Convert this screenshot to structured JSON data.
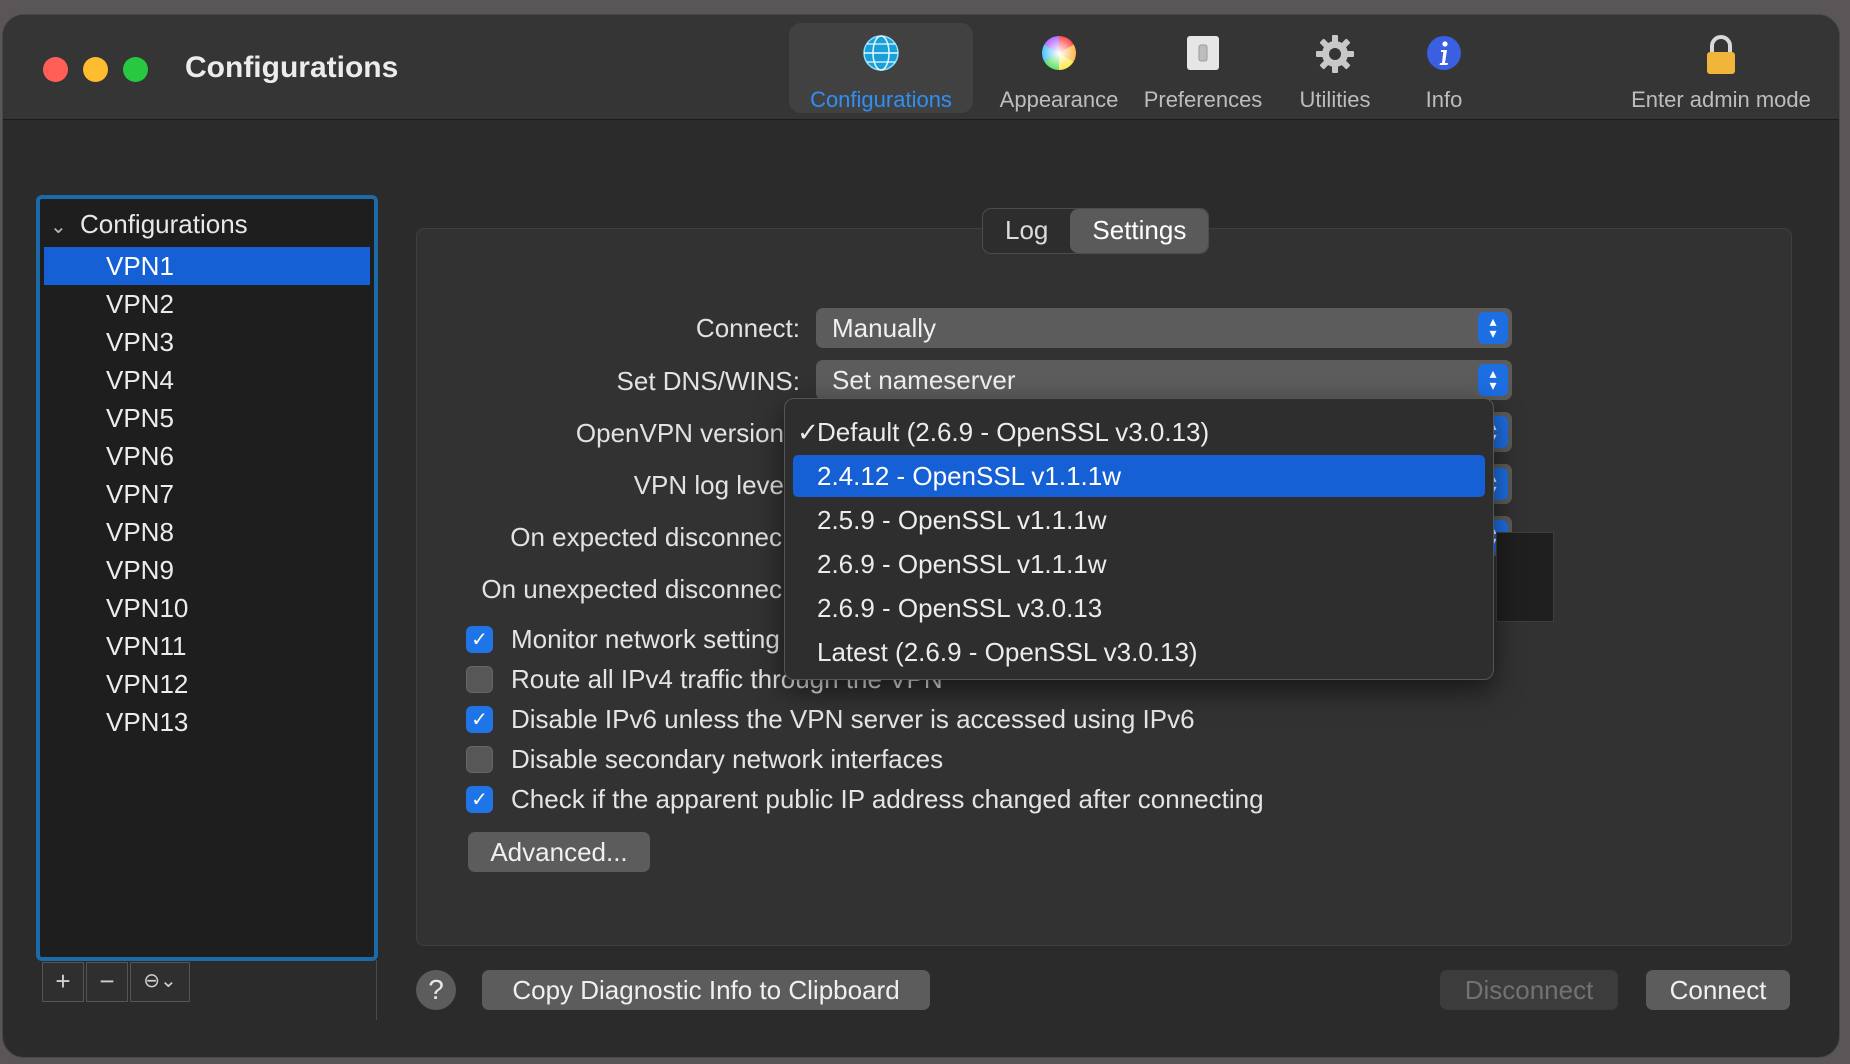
{
  "window": {
    "title": "Configurations"
  },
  "toolbar": {
    "items": [
      {
        "label": "Configurations",
        "icon": "globe-icon"
      },
      {
        "label": "Appearance",
        "icon": "color-wheel-icon"
      },
      {
        "label": "Preferences",
        "icon": "switch-icon"
      },
      {
        "label": "Utilities",
        "icon": "gear-icon"
      },
      {
        "label": "Info",
        "icon": "info-icon"
      }
    ],
    "admin": {
      "label": "Enter admin mode",
      "icon": "lock-icon"
    }
  },
  "sidebar": {
    "group_label": "Configurations",
    "items": [
      "VPN1",
      "VPN2",
      "VPN3",
      "VPN4",
      "VPN5",
      "VPN6",
      "VPN7",
      "VPN8",
      "VPN9",
      "VPN10",
      "VPN11",
      "VPN12",
      "VPN13"
    ],
    "selected": "VPN1",
    "tools": {
      "add": "+",
      "remove": "−",
      "more": "⊖⌄"
    }
  },
  "tabs": {
    "log": "Log",
    "settings": "Settings",
    "active": "Settings"
  },
  "settings": {
    "connect_label": "Connect:",
    "connect_value": "Manually",
    "dns_label": "Set DNS/WINS:",
    "dns_value": "Set nameserver",
    "openvpn_version_label": "OpenVPN version",
    "log_level_label": "VPN log leve",
    "expected_disconnect_label": "On expected disconnec",
    "unexpected_disconnect_label": "On unexpected disconnec",
    "checkboxes": [
      {
        "label": "Monitor network setting",
        "checked": true
      },
      {
        "label": "Route all IPv4 traffic through the VPN",
        "checked": false
      },
      {
        "label": "Disable IPv6 unless the VPN server is accessed using IPv6",
        "checked": true
      },
      {
        "label": "Disable secondary network interfaces",
        "checked": false
      },
      {
        "label": "Check if the apparent public IP address changed after connecting",
        "checked": true
      }
    ],
    "advanced_button": "Advanced..."
  },
  "version_menu": {
    "items": [
      "Default (2.6.9 - OpenSSL v3.0.13)",
      "2.4.12 - OpenSSL v1.1.1w",
      "2.5.9 - OpenSSL v1.1.1w",
      "2.6.9 - OpenSSL v1.1.1w",
      "2.6.9 - OpenSSL v3.0.13",
      "Latest (2.6.9 - OpenSSL v3.0.13)"
    ],
    "checked_index": 0,
    "highlighted_index": 1,
    "check_mark": "✓"
  },
  "footer": {
    "help": "?",
    "copy_diag": "Copy Diagnostic Info to Clipboard",
    "disconnect": "Disconnect",
    "connect": "Connect"
  },
  "colors": {
    "accent": "#1560d4",
    "toolbar_active_text": "#2f8ff5",
    "checkbox_on": "#1f74e8"
  }
}
